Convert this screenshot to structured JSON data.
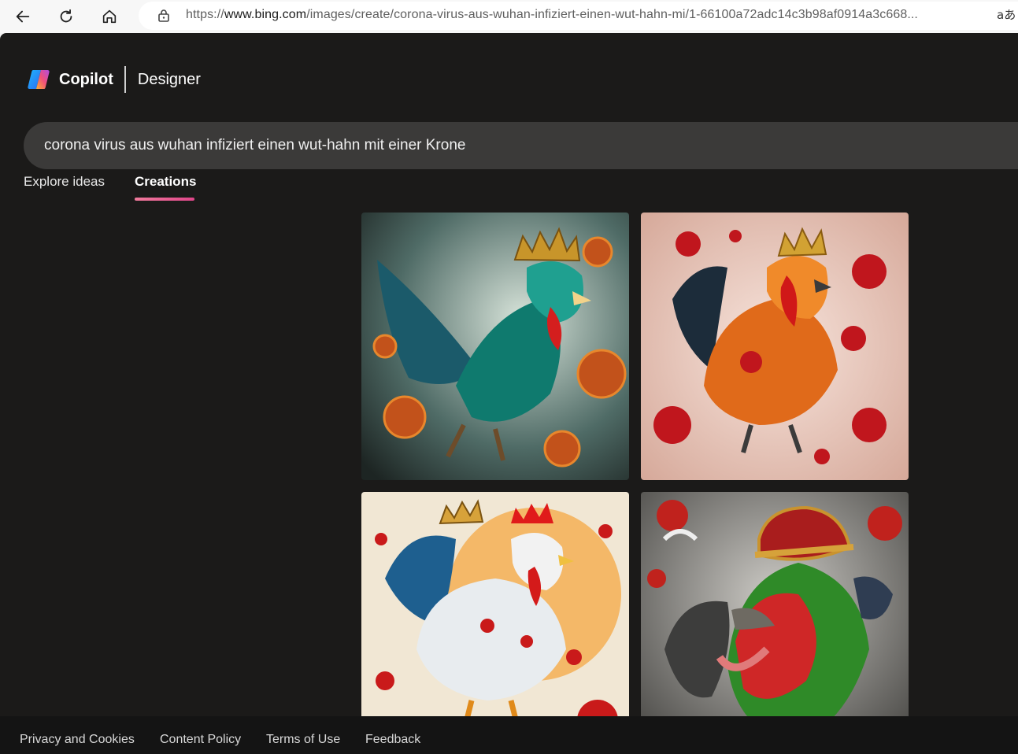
{
  "browser": {
    "url_prefix": "https://",
    "url_host": "www.bing.com",
    "url_path": "/images/create/corona-virus-aus-wuhan-infiziert-einen-wut-hahn-mi/1-66100a72adc14c3b98af0914a3c668...",
    "read_aloud_glyph": "aあ"
  },
  "brand": {
    "copilot": "Copilot",
    "designer": "Designer"
  },
  "search": {
    "query": "corona virus aus wuhan infiziert einen wut-hahn mit einer Krone"
  },
  "tabs": [
    {
      "label": "Explore ideas",
      "active": false
    },
    {
      "label": "Creations",
      "active": true
    }
  ],
  "images": [
    {
      "subject": "teal-rooster-with-crown-and-viruses",
      "bg": "#2d3a3a"
    },
    {
      "subject": "orange-rooster-with-crown-and-viruses",
      "bg": "#e9c7bb"
    },
    {
      "subject": "white-rooster-with-crown-and-viruses",
      "bg": "#f2e6cf"
    },
    {
      "subject": "screaming-rooster-with-red-crown",
      "bg": "#7c7b78"
    }
  ],
  "footer": {
    "links": [
      "Privacy and Cookies",
      "Content Policy",
      "Terms of Use",
      "Feedback"
    ]
  },
  "colors": {
    "app_bg": "#1b1a19",
    "search_bg": "#3b3a39",
    "tab_accent": "#e0468a",
    "footer_bg": "#141414"
  }
}
